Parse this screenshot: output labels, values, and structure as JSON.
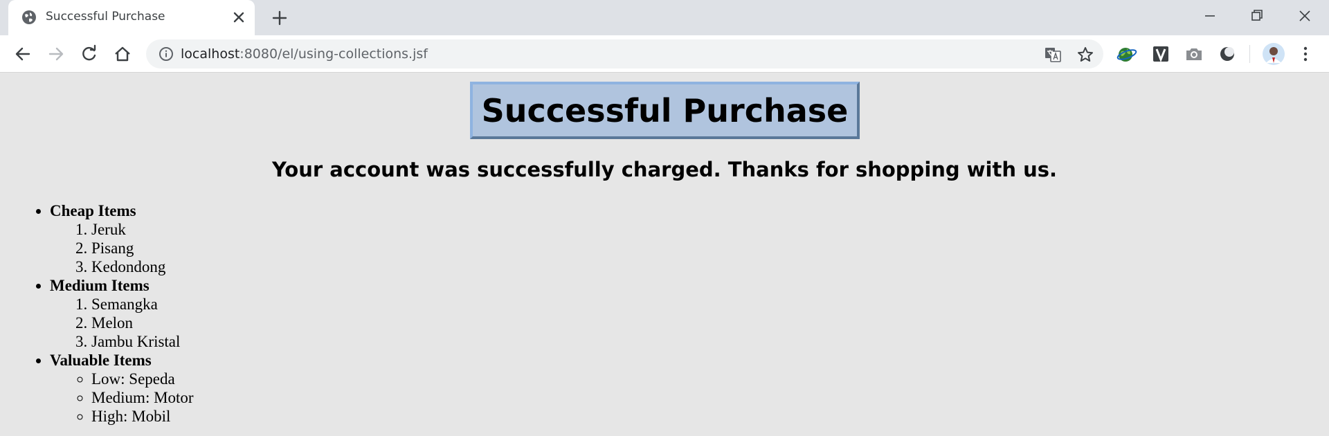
{
  "browser": {
    "tab_title": "Successful Purchase",
    "url_host": "localhost",
    "url_path": ":8080/el/using-collections.jsf"
  },
  "icons": {
    "favicon": "globe-icon",
    "tab_close": "close-icon",
    "new_tab": "plus-icon",
    "back": "arrow-left-icon",
    "forward": "arrow-right-icon",
    "reload": "reload-icon",
    "home": "home-icon",
    "site_info": "info-icon",
    "translate": "translate-icon",
    "bookmark": "star-icon",
    "extensions": [
      "globe-extension-icon",
      "vimium-icon",
      "camera-icon",
      "dark-reader-icon"
    ],
    "profile": "avatar",
    "menu": "kebab-menu-icon"
  },
  "colors": {
    "page_background": "#e6e6e6",
    "title_box": "#b0c4de"
  },
  "page": {
    "heading": "Successful Purchase",
    "message": "Your account was successfully charged. Thanks for shopping with us.",
    "categories": [
      {
        "label": "Cheap Items",
        "list_type": "ordered",
        "items": [
          "Jeruk",
          "Pisang",
          "Kedondong"
        ]
      },
      {
        "label": "Medium Items",
        "list_type": "ordered",
        "items": [
          "Semangka",
          "Melon",
          "Jambu Kristal"
        ]
      },
      {
        "label": "Valuable Items",
        "list_type": "unordered",
        "items": [
          "Low: Sepeda",
          "Medium: Motor",
          "High: Mobil"
        ]
      }
    ]
  }
}
